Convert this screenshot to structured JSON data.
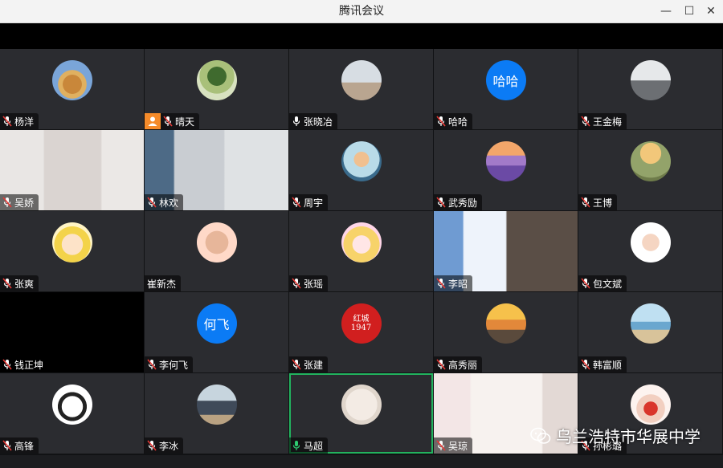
{
  "window": {
    "title": "腾讯会议",
    "minimize_icon": "—",
    "maximize_icon": "☐",
    "close_icon": "✕"
  },
  "participants": [
    {
      "name": "杨洋",
      "avatar": "photo-autumn-tree",
      "mic": "muted"
    },
    {
      "name": "晴天",
      "avatar": "photo-green-tree",
      "mic": "muted",
      "host": true
    },
    {
      "name": "张晓冶",
      "avatar": "photo-person-square",
      "mic": "on"
    },
    {
      "name": "哈哈",
      "avatar_text": "哈哈",
      "mic": "muted"
    },
    {
      "name": "王金梅",
      "avatar": "photo-person-street",
      "mic": "muted"
    },
    {
      "name": "吴娇",
      "video": "girl-glasses",
      "mic": "muted"
    },
    {
      "name": "林欢",
      "video": "room-door",
      "mic": "muted"
    },
    {
      "name": "周宇",
      "avatar": "photo-anime",
      "mic": "muted"
    },
    {
      "name": "武秀励",
      "avatar": "photo-lavender",
      "mic": "muted"
    },
    {
      "name": "王博",
      "avatar": "photo-sunset-blur",
      "mic": "muted"
    },
    {
      "name": "张爽",
      "avatar": "photo-cartoon-girl",
      "mic": "muted"
    },
    {
      "name": "崔新杰",
      "avatar": "photo-cartoon-family",
      "mic": "none"
    },
    {
      "name": "张瑶",
      "avatar": "photo-sailor-moon",
      "mic": "muted"
    },
    {
      "name": "李昭",
      "video": "bright-window",
      "mic": "muted"
    },
    {
      "name": "包文斌",
      "avatar": "photo-child",
      "mic": "muted"
    },
    {
      "name": "钱正坤",
      "video": "black",
      "mic": "muted"
    },
    {
      "name": "李何飞",
      "avatar_text": "何飞",
      "mic": "muted"
    },
    {
      "name": "张建",
      "avatar": "photo-red-1947",
      "mic": "muted",
      "avatar_caption": "红城1947"
    },
    {
      "name": "高秀丽",
      "avatar": "photo-beach-sunset",
      "mic": "muted"
    },
    {
      "name": "韩富顺",
      "avatar": "photo-beach-person",
      "mic": "muted"
    },
    {
      "name": "高锋",
      "avatar": "photo-cartoon-boy",
      "mic": "muted"
    },
    {
      "name": "李冰",
      "avatar": "photo-person-sitting",
      "mic": "muted"
    },
    {
      "name": "马超",
      "avatar": "photo-bride",
      "mic": "speaking",
      "active": true
    },
    {
      "name": "吴琼",
      "video": "woman-glasses-room",
      "mic": "muted"
    },
    {
      "name": "孙彬璐",
      "avatar": "photo-woman-mask",
      "mic": "muted"
    }
  ],
  "watermark": {
    "text": "乌兰浩特市华展中学",
    "icon": "wechat-icon"
  },
  "colors": {
    "active_border": "#22b35e",
    "text_avatar_bg": "#0b7bf5",
    "host_badge": "#f58b2a",
    "muted_red": "#e53935"
  }
}
